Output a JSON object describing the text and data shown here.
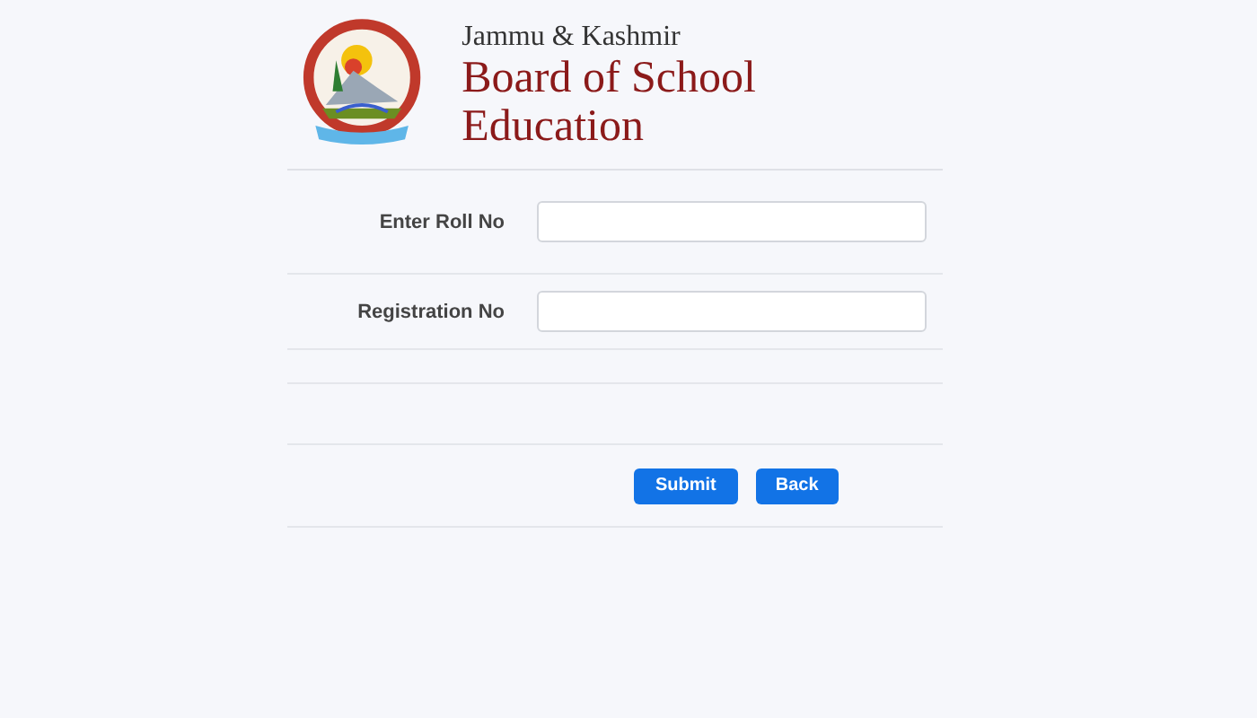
{
  "header": {
    "subtitle": "Jammu & Kashmir",
    "title": "Board of School Education"
  },
  "fields": [
    {
      "label": "Enter Roll No"
    },
    {
      "label": "Registration No"
    }
  ],
  "buttons": [
    "Submit",
    "Back"
  ]
}
